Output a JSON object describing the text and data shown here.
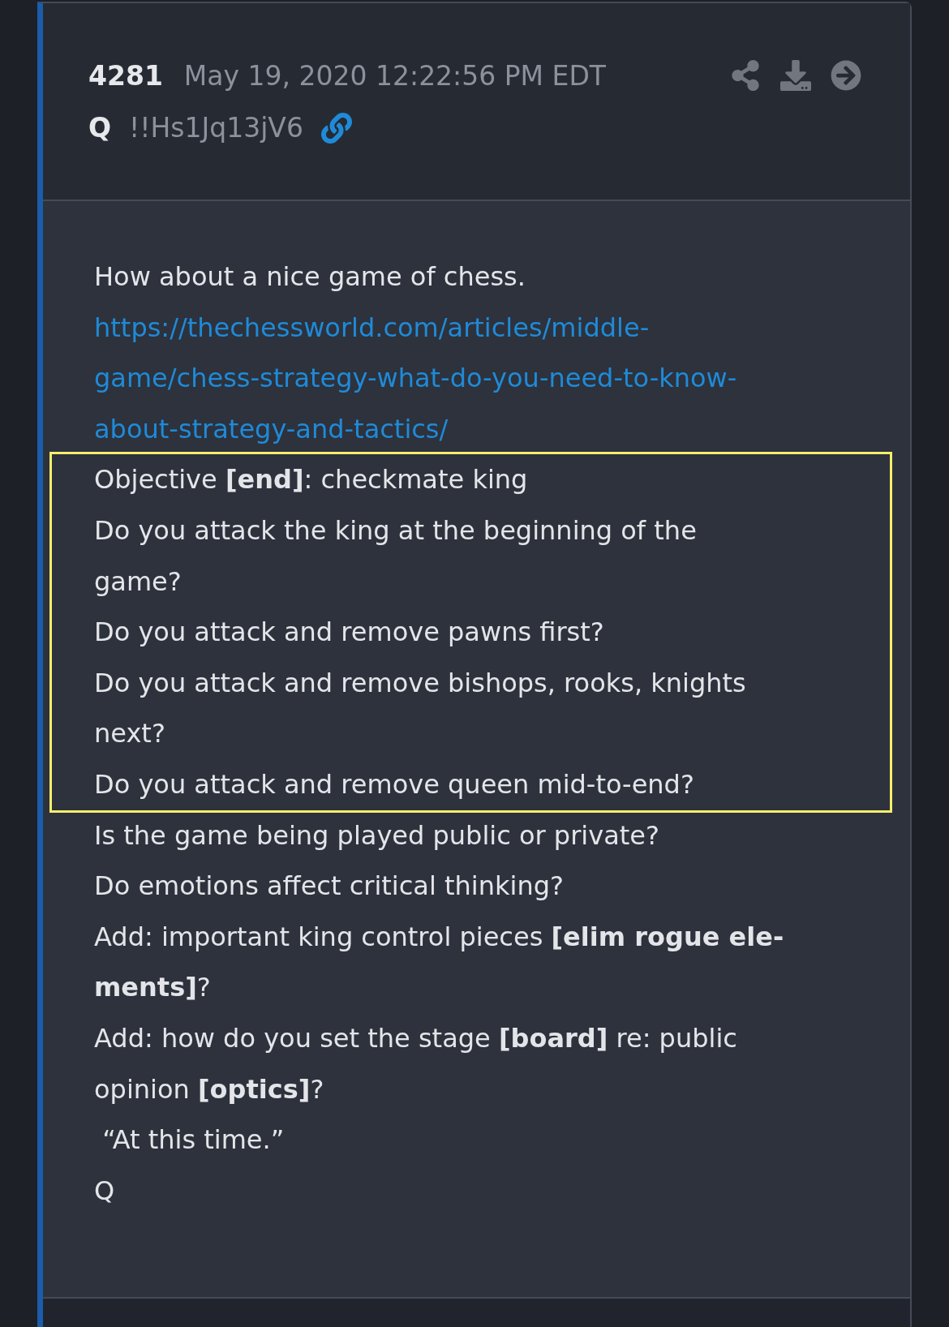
{
  "post": {
    "number": "4281",
    "date": "May 19, 2020 12:22:56 PM EDT",
    "author": "Q",
    "tripcode": "!!Hs1Jq13jV6",
    "actions": [
      {
        "kind": "share"
      },
      {
        "kind": "download"
      },
      {
        "kind": "forward"
      }
    ],
    "body": [
      {
        "kind": "text",
        "lines": [
          "How about a nice game of chess."
        ],
        "highlighted": false
      },
      {
        "kind": "link",
        "lines": [
          "https://thechessworld.com/articles/middle-",
          "game/chess-strategy-what-do-you-need-to-know-",
          "about-strategy-and-tactics/"
        ],
        "highlighted": false
      },
      {
        "kind": "text",
        "lines": [
          "Objective **[end]**: checkmate king"
        ],
        "highlighted": true
      },
      {
        "kind": "text",
        "lines": [
          "Do you attack the king at the beginning of the",
          "game?"
        ],
        "highlighted": true
      },
      {
        "kind": "text",
        "lines": [
          "Do you attack and remove pawns first?"
        ],
        "highlighted": true
      },
      {
        "kind": "text",
        "lines": [
          "Do you attack and remove bishops, rooks, knights",
          "next?"
        ],
        "highlighted": true
      },
      {
        "kind": "text",
        "lines": [
          "Do you attack and remove queen mid-to-end?"
        ],
        "highlighted": true
      },
      {
        "kind": "text",
        "lines": [
          "Is the game being played public or private?"
        ],
        "highlighted": false
      },
      {
        "kind": "text",
        "lines": [
          "Do emotions affect critical thinking?"
        ],
        "highlighted": false
      },
      {
        "kind": "text",
        "lines": [
          "Add: important king control pieces **[elim rogue ele-**",
          "**ments]**?"
        ],
        "highlighted": false
      },
      {
        "kind": "text",
        "lines": [
          "Add: how do you set the stage **[board]** re: public",
          "opinion **[optics]**?"
        ],
        "highlighted": false
      },
      {
        "kind": "text",
        "lines": [
          " “At this time.”"
        ],
        "highlighted": false
      },
      {
        "kind": "text",
        "lines": [
          "Q"
        ],
        "highlighted": false
      }
    ]
  }
}
